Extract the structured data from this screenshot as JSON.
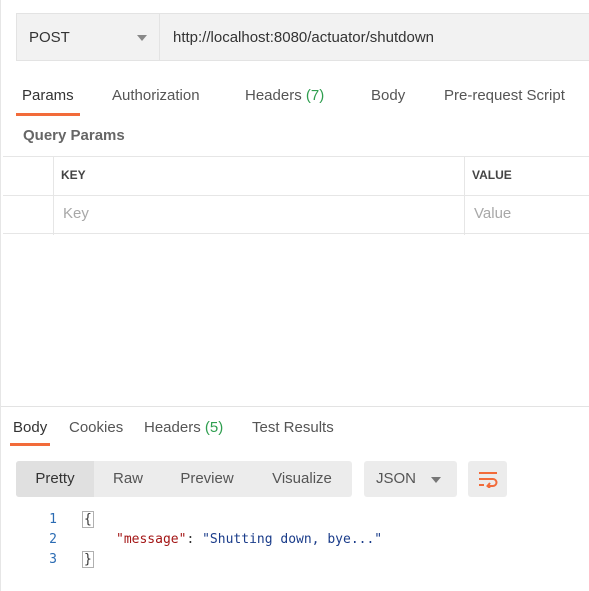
{
  "request": {
    "method": "POST",
    "url": "http://localhost:8080/actuator/shutdown"
  },
  "request_tabs": [
    {
      "label": "Params",
      "count": ""
    },
    {
      "label": "Authorization",
      "count": ""
    },
    {
      "label": "Headers",
      "count": "(7)"
    },
    {
      "label": "Body",
      "count": ""
    },
    {
      "label": "Pre-request Script",
      "count": ""
    }
  ],
  "query_params": {
    "title": "Query Params",
    "columns": {
      "key": "KEY",
      "value": "VALUE"
    },
    "placeholders": {
      "key": "Key",
      "value": "Value"
    }
  },
  "response_tabs": [
    {
      "label": "Body",
      "count": ""
    },
    {
      "label": "Cookies",
      "count": ""
    },
    {
      "label": "Headers",
      "count": "(5)"
    },
    {
      "label": "Test Results",
      "count": ""
    }
  ],
  "response_view": {
    "modes": [
      "Pretty",
      "Raw",
      "Preview",
      "Visualize"
    ],
    "active_mode": "Pretty",
    "format": "JSON",
    "wrap_icon": "wrap-lines-icon"
  },
  "response_body": {
    "line_numbers": [
      "1",
      "2",
      "3"
    ],
    "open_brace": "{",
    "key": "\"message\"",
    "colon": ": ",
    "value": "\"Shutting down, bye...\"",
    "close_brace": "}"
  },
  "colors": {
    "accent": "#f26b3a",
    "count": "#2f9e4f"
  }
}
